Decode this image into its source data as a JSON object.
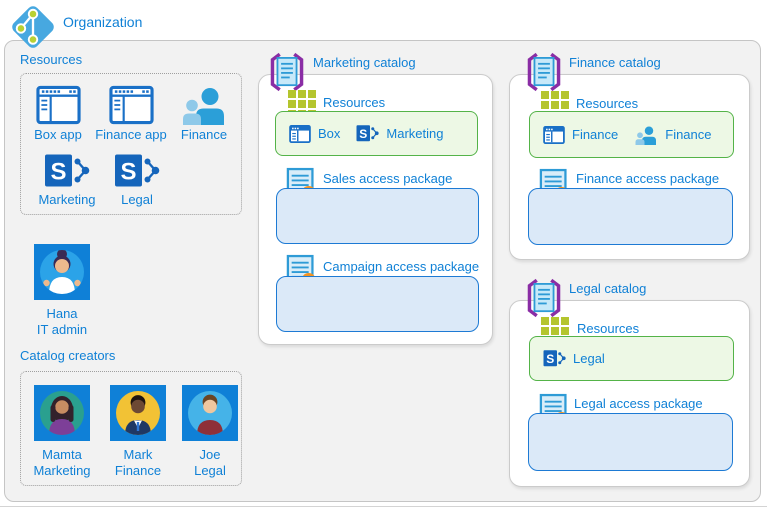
{
  "organization": {
    "label": "Organization"
  },
  "resources_panel": {
    "title": "Resources",
    "items": [
      {
        "label": "Box app",
        "icon": "app-window-icon"
      },
      {
        "label": "Finance app",
        "icon": "app-window-icon"
      },
      {
        "label": "Finance",
        "icon": "people-group-icon"
      },
      {
        "label": "Marketing",
        "icon": "sharepoint-icon"
      },
      {
        "label": "Legal",
        "icon": "sharepoint-icon"
      }
    ]
  },
  "it_admin": {
    "name": "Hana",
    "role": "IT admin"
  },
  "catalog_creators": {
    "title": "Catalog creators",
    "people": [
      {
        "name": "Mamta",
        "role": "Marketing"
      },
      {
        "name": "Mark",
        "role": "Finance"
      },
      {
        "name": "Joe",
        "role": "Legal"
      }
    ]
  },
  "catalogs": [
    {
      "title": "Marketing catalog",
      "resources_label": "Resources",
      "resources": [
        {
          "label": "Box",
          "icon": "app-window-icon"
        },
        {
          "label": "Marketing",
          "icon": "sharepoint-icon"
        }
      ],
      "packages": [
        {
          "label": "Sales access package"
        },
        {
          "label": "Campaign access package"
        }
      ]
    },
    {
      "title": "Finance catalog",
      "resources_label": "Resources",
      "resources": [
        {
          "label": "Finance",
          "icon": "app-window-icon"
        },
        {
          "label": "Finance",
          "icon": "people-group-icon"
        }
      ],
      "packages": [
        {
          "label": "Finance access package"
        }
      ]
    },
    {
      "title": "Legal catalog",
      "resources_label": "Resources",
      "resources": [
        {
          "label": "Legal",
          "icon": "sharepoint-icon"
        }
      ],
      "packages": [
        {
          "label": "Legal access package"
        }
      ]
    }
  ],
  "colors": {
    "accent_blue_text": "#1081d6",
    "boundary_bg": "#f2f2f2",
    "green_box_bg": "#edf8e5",
    "green_box_border": "#54b348",
    "package_box_bg": "#dbe9f8",
    "package_box_border": "#1d7ad4",
    "catalog_bracket_purple": "#8a2da5",
    "grid_icon_green": "#b4c52e",
    "seal_orange": "#f39322",
    "ribbon_purple": "#7b2d8e",
    "avatar_square_blue": "#0f80d7",
    "azure_ad_node_green": "#b8d133"
  }
}
